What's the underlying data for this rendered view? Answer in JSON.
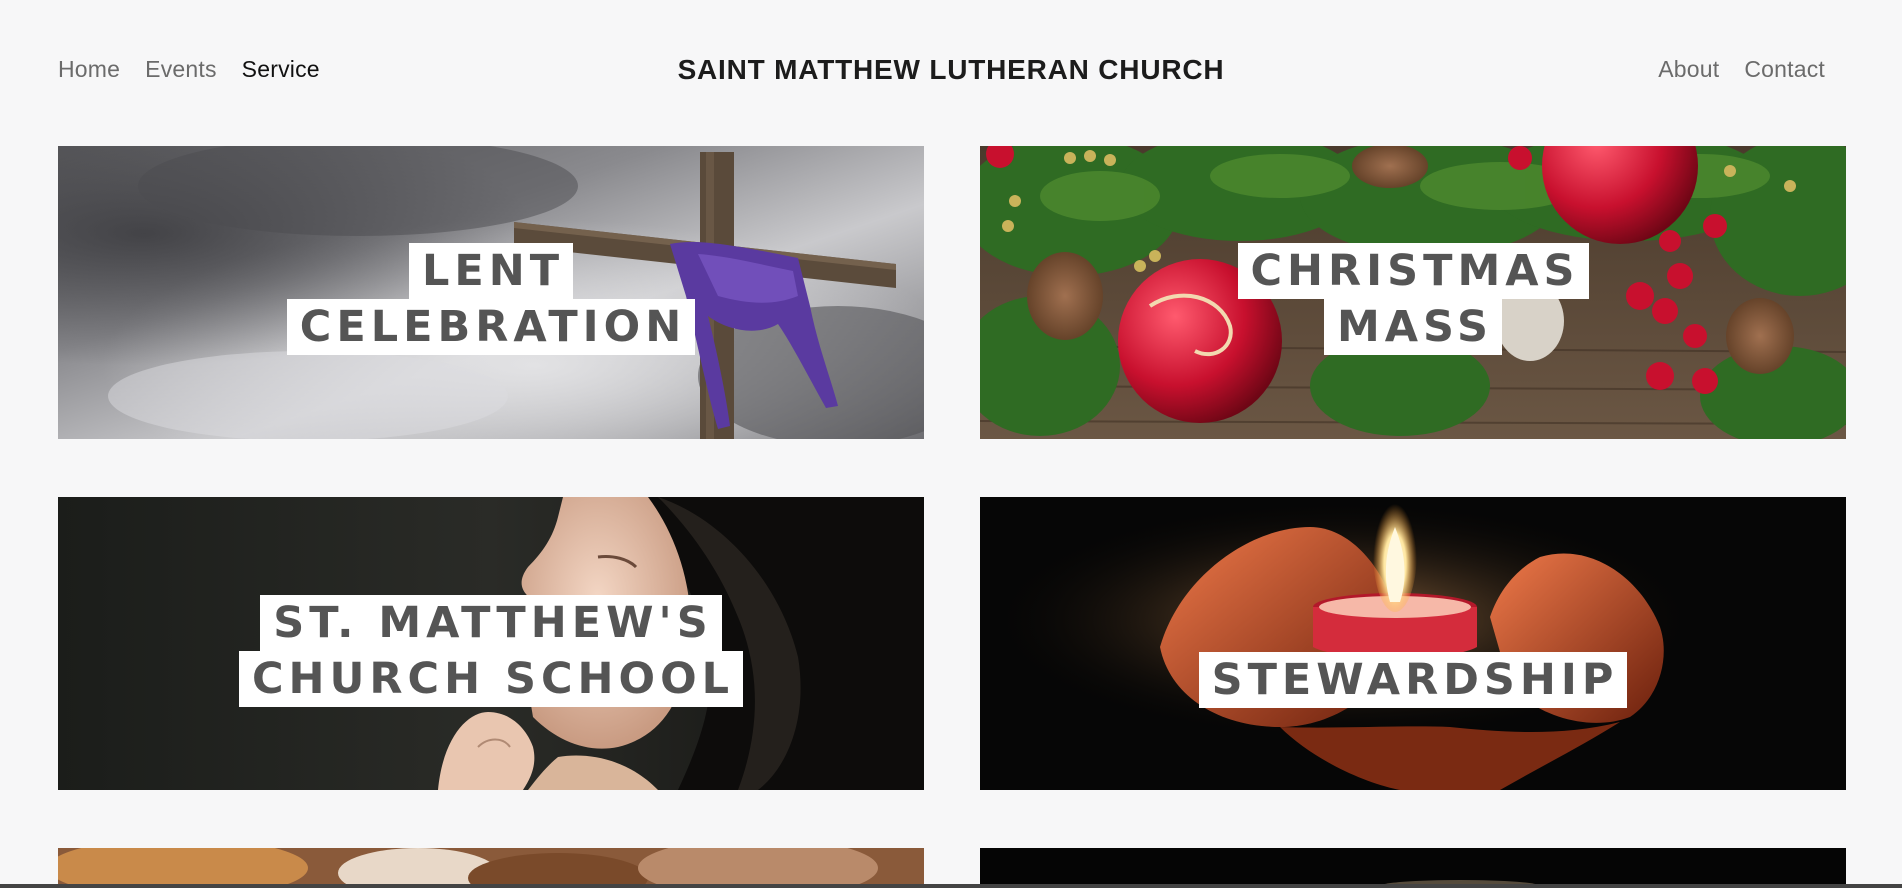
{
  "nav": {
    "left": [
      "Home",
      "Events",
      "Service"
    ],
    "active": "Service",
    "right": [
      "About",
      "Contact"
    ]
  },
  "site_title": "SAINT MATTHEW LUTHERAN CHURCH",
  "tiles": [
    {
      "lines": [
        "LENT",
        "CELEBRATION"
      ],
      "image": "cross-with-purple-cloth-under-storm-clouds"
    },
    {
      "lines": [
        "CHRISTMAS",
        "MASS"
      ],
      "image": "christmas-ornaments-and-pine-branches"
    },
    {
      "lines": [
        "ST. MATTHEW'S",
        "CHURCH SCHOOL"
      ],
      "image": "woman-praying"
    },
    {
      "lines": [
        "STEWARDSHIP"
      ],
      "image": "hands-holding-candle"
    }
  ]
}
